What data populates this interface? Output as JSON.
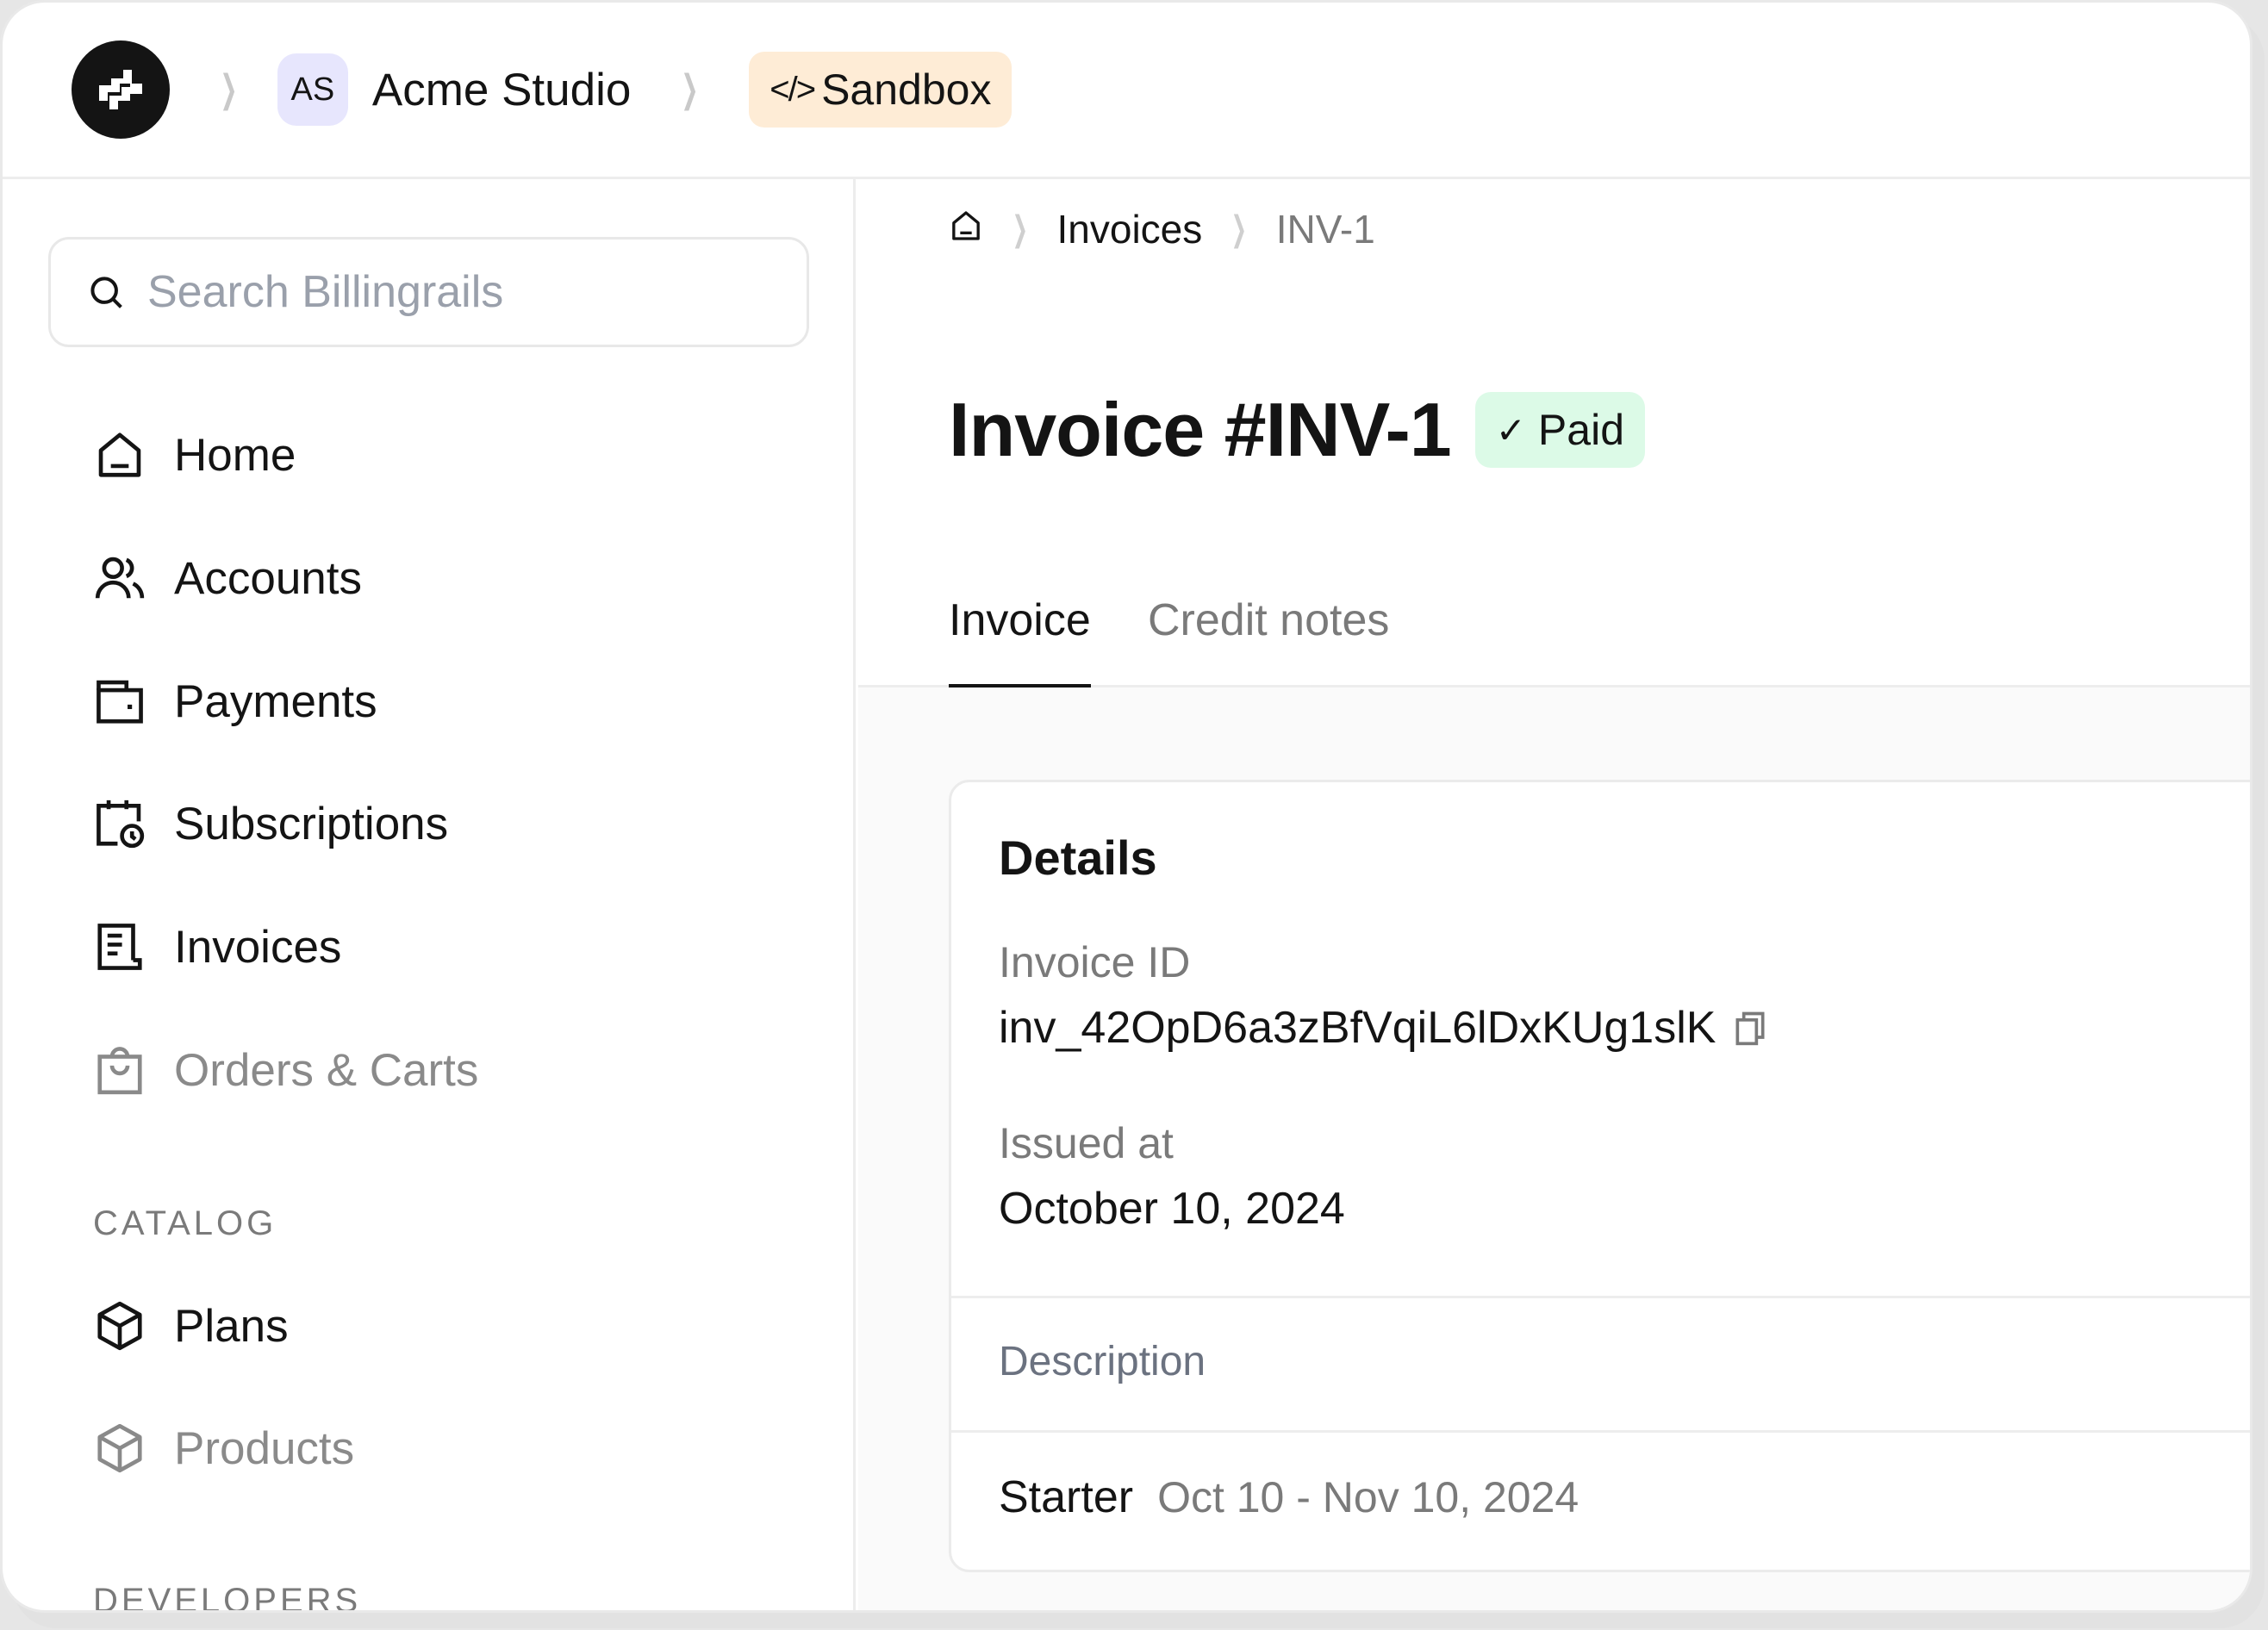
{
  "header": {
    "logo": "billingrails-logo-icon",
    "org_avatar_initials": "AS",
    "org_name": "Acme Studio",
    "environment_label": "Sandbox",
    "environment_icon": "code-icon",
    "colors": {
      "avatar_bg": "#e7e6fd",
      "environment_bg": "#feecd6"
    }
  },
  "sidebar": {
    "search": {
      "placeholder": "Search Billingrails",
      "value": ""
    },
    "items": [
      {
        "label": "Home",
        "icon": "home-icon",
        "enabled": true
      },
      {
        "label": "Accounts",
        "icon": "users-icon",
        "enabled": true
      },
      {
        "label": "Payments",
        "icon": "wallet-icon",
        "enabled": true
      },
      {
        "label": "Subscriptions",
        "icon": "calendar-clock-icon",
        "enabled": true
      },
      {
        "label": "Invoices",
        "icon": "receipt-icon",
        "enabled": true
      },
      {
        "label": "Orders & Carts",
        "icon": "shopping-bag-icon",
        "enabled": false
      }
    ],
    "sections": [
      {
        "label": "CATALOG",
        "items": [
          {
            "label": "Plans",
            "icon": "box-icon",
            "enabled": true
          },
          {
            "label": "Products",
            "icon": "box-icon",
            "enabled": false
          }
        ]
      },
      {
        "label": "DEVELOPERS",
        "items": []
      }
    ]
  },
  "main": {
    "breadcrumb": [
      {
        "label": "",
        "icon": "home-icon"
      },
      {
        "label": "Invoices"
      },
      {
        "label": "INV-1"
      }
    ],
    "title": "Invoice #INV-1",
    "status": {
      "label": "Paid",
      "icon": "check-icon",
      "color_bg": "#dcfae7"
    },
    "tabs": [
      {
        "label": "Invoice",
        "active": true
      },
      {
        "label": "Credit notes",
        "active": false
      }
    ],
    "details": {
      "title": "Details",
      "fields": [
        {
          "label": "Invoice ID",
          "value": "inv_42OpD6a3zBfVqiL6lDxKUg1slK",
          "copyable": true
        },
        {
          "label": "Issued at",
          "value": "October 10, 2024"
        }
      ],
      "line_items_header": "Description",
      "line_items": [
        {
          "name": "Starter",
          "period": "Oct 10 - Nov 10, 2024"
        }
      ]
    }
  }
}
